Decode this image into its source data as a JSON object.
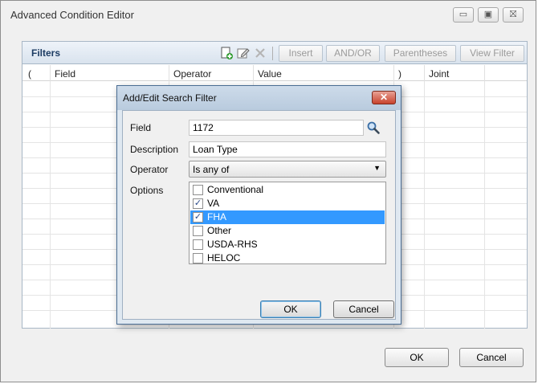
{
  "window": {
    "title": "Advanced Condition Editor",
    "minimize_glyph": "▭",
    "maximize_glyph": "▣",
    "close_glyph": "⛝"
  },
  "filters_panel": {
    "title": "Filters",
    "toolbar": {
      "icons": [
        "add-filter-icon",
        "edit-filter-icon",
        "delete-filter-icon"
      ],
      "insert_label": "Insert",
      "and_or_label": "AND/OR",
      "parentheses_label": "Parentheses",
      "view_filter_label": "View Filter"
    },
    "columns": [
      "(",
      "Field",
      "Operator",
      "Value",
      ")",
      "Joint"
    ]
  },
  "footer": {
    "ok_label": "OK",
    "cancel_label": "Cancel"
  },
  "dialog": {
    "title": "Add/Edit Search Filter",
    "close_glyph": "✕",
    "field_label": "Field",
    "field_value": "1172",
    "description_label": "Description",
    "description_value": "Loan Type",
    "operator_label": "Operator",
    "operator_value": "Is any of",
    "options_label": "Options",
    "options": [
      {
        "label": "Conventional",
        "checked": false,
        "selected": false
      },
      {
        "label": "VA",
        "checked": true,
        "selected": false
      },
      {
        "label": "FHA",
        "checked": true,
        "selected": true
      },
      {
        "label": "Other",
        "checked": false,
        "selected": false
      },
      {
        "label": "USDA-RHS",
        "checked": false,
        "selected": false
      },
      {
        "label": "HELOC",
        "checked": false,
        "selected": false
      }
    ],
    "ok_label": "OK",
    "cancel_label": "Cancel"
  },
  "colors": {
    "selection": "#3399ff",
    "panel_title": "#1c3c63",
    "dialog_close": "#c8432d"
  }
}
